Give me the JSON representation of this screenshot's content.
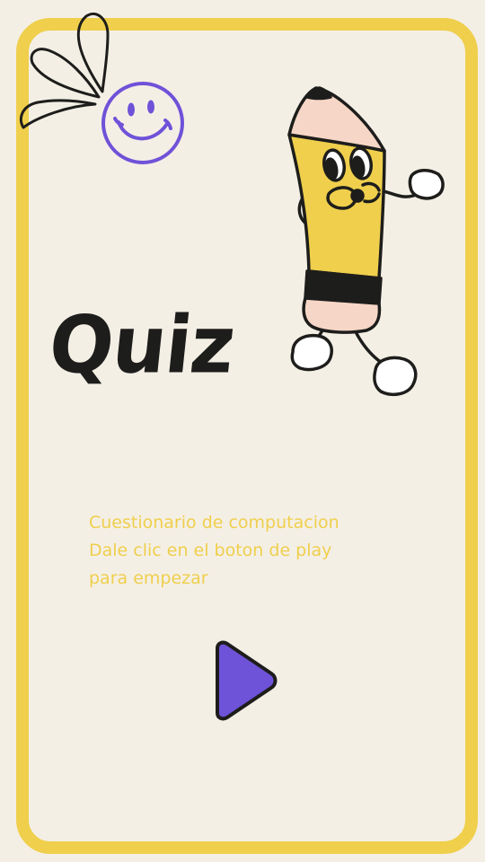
{
  "title": "Quiz",
  "description": [
    "Cuestionario de computacion",
    "Dale clic en el boton de play",
    "para empezar"
  ],
  "colors": {
    "background": "#f4efe5",
    "frame": "#efcf4c",
    "accent_purple": "#6e52d8",
    "ink": "#1d1d1b",
    "pencil_body": "#efcf4c",
    "eraser": "#f6d6c6"
  },
  "icons": {
    "play": "play-icon",
    "smiley": "smiley-face-icon",
    "petals": "petals-icon",
    "mascot": "pencil-mascot-icon"
  }
}
